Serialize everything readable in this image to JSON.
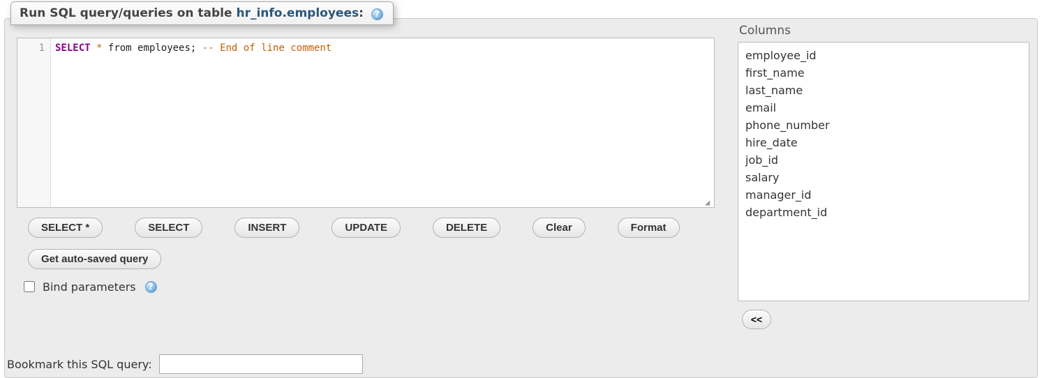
{
  "header": {
    "title_prefix": "Run SQL query/queries on table ",
    "table_name": "hr_info.employees",
    "title_suffix": ":",
    "help_glyph": "?"
  },
  "editor": {
    "line_number": "1",
    "tokens": {
      "select": "SELECT",
      "star": "*",
      "from": "from",
      "table": "employees",
      "semi": ";",
      "comment": "-- End of line comment"
    }
  },
  "buttons": {
    "select_star": "SELECT *",
    "select": "SELECT",
    "insert": "INSERT",
    "update": "UPDATE",
    "delete": "DELETE",
    "clear": "Clear",
    "format": "Format",
    "get_auto_saved": "Get auto-saved query"
  },
  "bind": {
    "label": "Bind parameters",
    "checked": false,
    "help_glyph": "?"
  },
  "bookmark": {
    "label": "Bookmark this SQL query:",
    "value": ""
  },
  "columns": {
    "title": "Columns",
    "items": [
      "employee_id",
      "first_name",
      "last_name",
      "email",
      "phone_number",
      "hire_date",
      "job_id",
      "salary",
      "manager_id",
      "department_id"
    ],
    "insert_button": "<<"
  }
}
